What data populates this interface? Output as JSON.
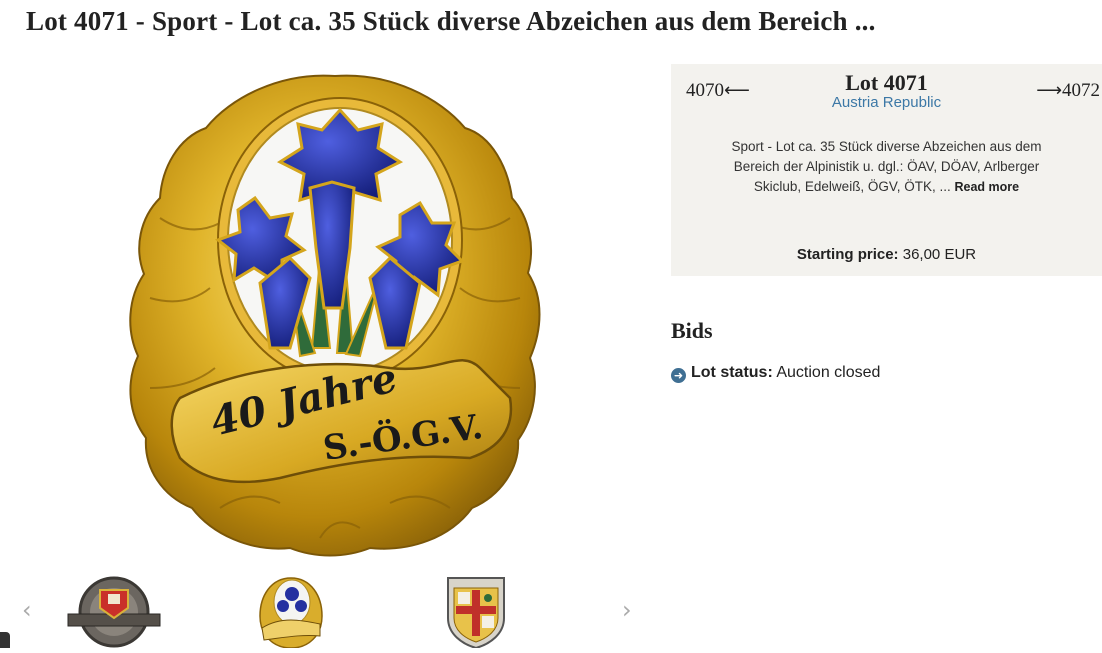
{
  "page": {
    "title": "Lot 4071 - Sport - Lot ca. 35 Stück diverse Abzeichen aus dem Bereich ..."
  },
  "gallery": {
    "main_badge_text_top": "40 Jahre",
    "main_badge_text_bottom": "S.-Ö.G.V.",
    "prev_arrow": "‹",
    "next_arrow": "›"
  },
  "lot_panel": {
    "prev_lot": "4070",
    "next_lot": "4072",
    "prev_arrow": "⟵",
    "next_arrow": "⟶",
    "lot_number": "Lot 4071",
    "country": "Austria Republic",
    "description": "Sport - Lot ca. 35 Stück diverse Abzeichen aus dem Bereich der Alpinistik u. dgl.: ÖAV, DÖAV, Arlberger Skiclub, Edelweiß, ÖGV, ÖTK, ...",
    "read_more": "Read more",
    "price_label": "Starting price:",
    "price_value": "36,00 EUR"
  },
  "bids": {
    "title": "Bids",
    "status_label": "Lot status:",
    "status_value": "Auction closed"
  },
  "colors": {
    "panel_bg": "#f3f2ee",
    "link": "#3c78a6",
    "status_icon": "#3f6f93",
    "gold": "#d4a51c",
    "enamel_blue": "#1d2a9a"
  },
  "icons": [
    "arrow-left-icon",
    "arrow-right-icon",
    "circle-arrow-right-icon",
    "chevron-left-icon",
    "chevron-right-icon"
  ]
}
